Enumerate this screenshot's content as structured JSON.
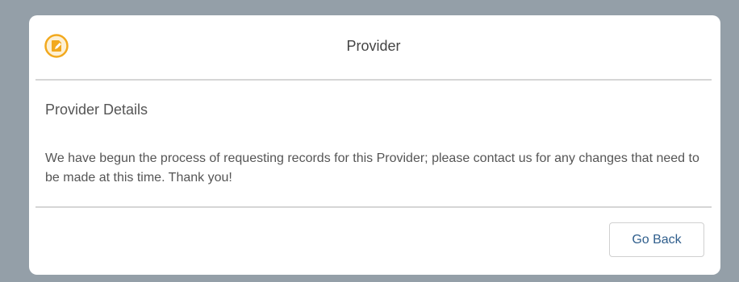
{
  "colors": {
    "backdrop": "#949fa8",
    "accent_icon": "#f2a91e",
    "button_text": "#2f5e8c",
    "divider": "#d6d6d6"
  },
  "modal": {
    "icon": "edit-note-icon",
    "title": "Provider",
    "section_heading": "Provider Details",
    "message": "We have begun the process of requesting records for this Provider; please contact us for any changes that need to be made at this time. Thank you!",
    "go_back_label": "Go Back"
  }
}
